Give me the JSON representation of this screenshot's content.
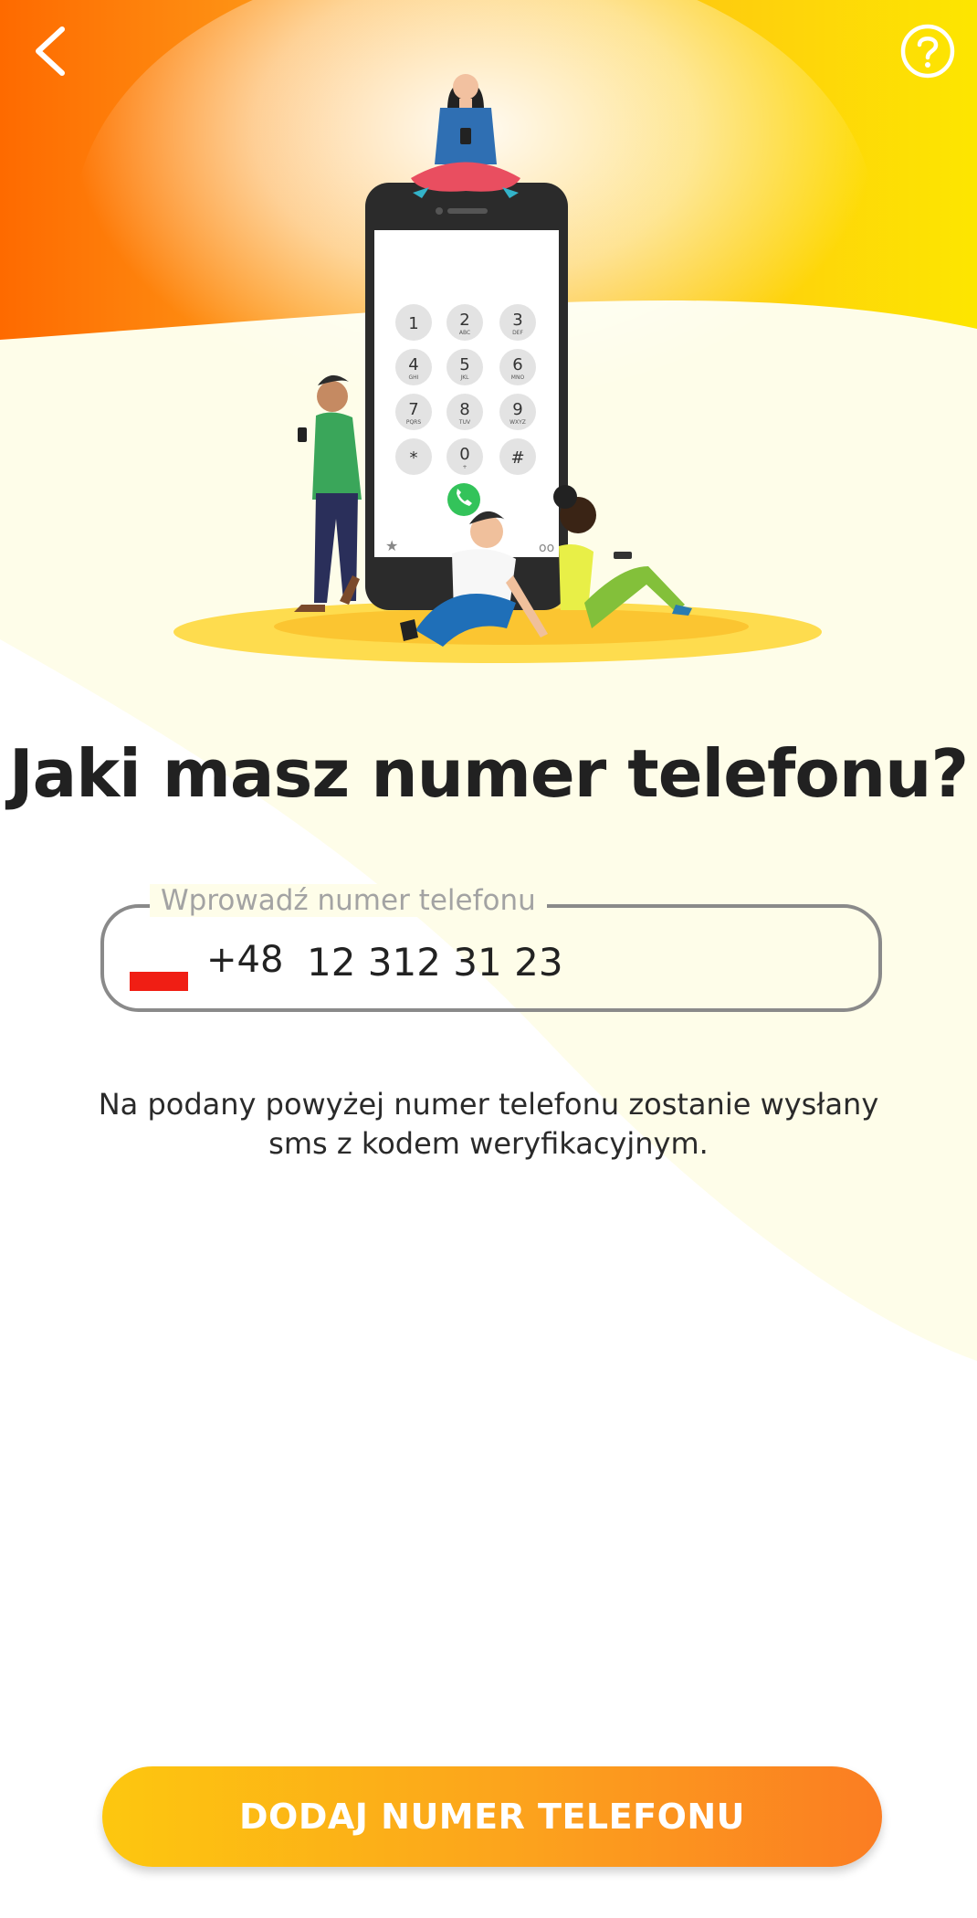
{
  "header": {
    "back_icon": "chevron-left-icon",
    "help_icon": "question-circle-icon"
  },
  "hero": {
    "dialer_keys": [
      {
        "digit": "1",
        "letters": ""
      },
      {
        "digit": "2",
        "letters": "ABC"
      },
      {
        "digit": "3",
        "letters": "DEF"
      },
      {
        "digit": "4",
        "letters": "GHI"
      },
      {
        "digit": "5",
        "letters": "JKL"
      },
      {
        "digit": "6",
        "letters": "MNO"
      },
      {
        "digit": "7",
        "letters": "PQRS"
      },
      {
        "digit": "8",
        "letters": "TUV"
      },
      {
        "digit": "9",
        "letters": "WXYZ"
      },
      {
        "digit": "*",
        "letters": ""
      },
      {
        "digit": "0",
        "letters": "+"
      },
      {
        "digit": "#",
        "letters": ""
      }
    ]
  },
  "title": "Jaki masz numer telefonu?",
  "phone_field": {
    "label": "Wprowadź numer telefonu",
    "country_flag": "poland-flag-icon",
    "country_code": "+48",
    "value": "12 312 31 23"
  },
  "description": "Na podany powyżej numer telefonu zostanie wysłany sms z kodem weryfikacyjnym.",
  "cta_label": "DODAJ NUMER TELEFONU",
  "colors": {
    "orange": "#fe6a00",
    "yellow": "#fde300",
    "cream": "#fefde9",
    "button_start": "#fdc70f",
    "button_end": "#fb7d22"
  }
}
